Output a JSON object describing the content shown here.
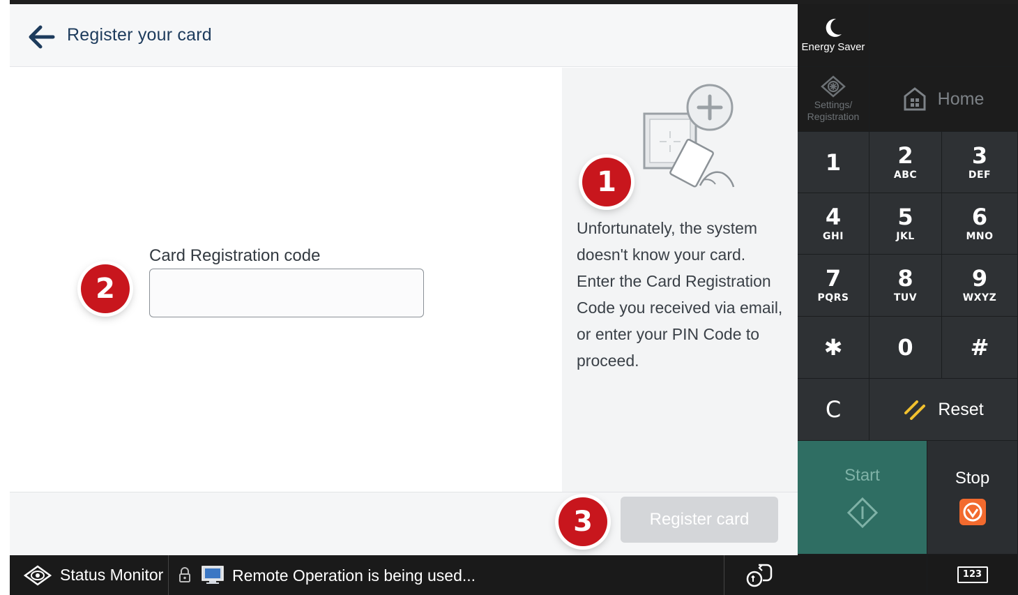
{
  "header": {
    "title": "Register your card"
  },
  "form": {
    "field_label": "Card Registration code",
    "field_value": "",
    "field_placeholder": ""
  },
  "info": {
    "message": "Unfortunately, the system doesn't know your card. Enter the Card Registration Code you received via email, or enter your PIN Code to proceed."
  },
  "markers": {
    "m1": "1",
    "m2": "2",
    "m3": "3"
  },
  "actions": {
    "register_label": "Register card"
  },
  "status_bar": {
    "monitor_label": "Status Monitor",
    "message": "Remote Operation is being used..."
  },
  "keypad": {
    "energy_label": "Energy Saver",
    "settings_label_line1": "Settings/",
    "settings_label_line2": "Registration",
    "home_label": "Home",
    "keys": [
      {
        "digit": "1",
        "letters": ""
      },
      {
        "digit": "2",
        "letters": "ABC"
      },
      {
        "digit": "3",
        "letters": "DEF"
      },
      {
        "digit": "4",
        "letters": "GHI"
      },
      {
        "digit": "5",
        "letters": "JKL"
      },
      {
        "digit": "6",
        "letters": "MNO"
      },
      {
        "digit": "7",
        "letters": "PQRS"
      },
      {
        "digit": "8",
        "letters": "TUV"
      },
      {
        "digit": "9",
        "letters": "WXYZ"
      },
      {
        "digit": "✱",
        "letters": ""
      },
      {
        "digit": "0",
        "letters": ""
      },
      {
        "digit": "#",
        "letters": ""
      }
    ],
    "clear_label": "C",
    "reset_label": "Reset",
    "start_label": "Start",
    "stop_label": "Stop",
    "keyboard_label": "123"
  },
  "colors": {
    "marker": "#c8161d",
    "start_bg": "#2f6e63",
    "stop_icon": "#f26a2e",
    "reset_icon": "#f2c12e",
    "title_text": "#1d3b5c"
  }
}
